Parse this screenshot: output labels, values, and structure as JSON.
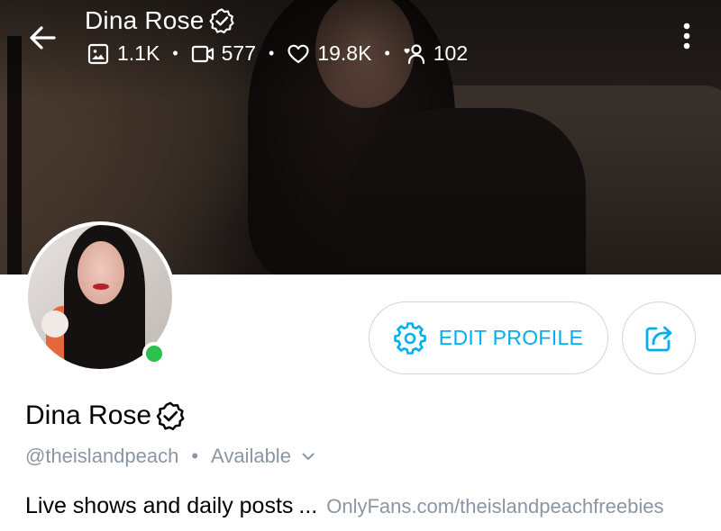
{
  "header": {
    "name": "Dina Rose",
    "stats": {
      "photos": "1.1K",
      "videos": "577",
      "likes": "19.8K",
      "fans": "102"
    },
    "icons": {
      "back": "arrow-left-icon",
      "more": "more-vertical-icon",
      "photos": "image-icon",
      "videos": "video-icon",
      "likes": "heart-icon",
      "fans": "fans-icon",
      "verified": "verified-badge-icon"
    }
  },
  "profile": {
    "name": "Dina Rose",
    "handle": "@theislandpeach",
    "separator": "•",
    "availability": "Available",
    "bio": "Live shows and daily posts",
    "ellipsis": "...",
    "link": "OnlyFans.com/theislandpeachfreebies",
    "online": true
  },
  "actions": {
    "edit_profile": "EDIT PROFILE",
    "share_icon": "share-icon",
    "settings_icon": "settings-gear-icon"
  },
  "colors": {
    "accent": "#00aff0",
    "muted": "#8a96a3",
    "online": "#2cc14f",
    "border": "#cfd5dc"
  }
}
